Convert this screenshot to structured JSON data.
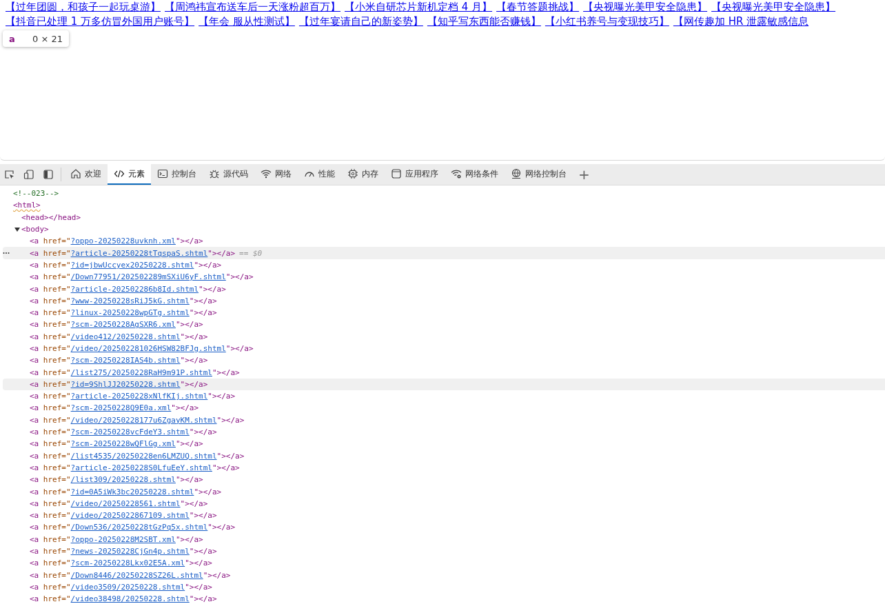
{
  "page": {
    "link_rows": [
      [
        "【过年团圆，和孩子一起玩桌游】",
        "【周鸿祎宣布送车后一天涨粉超百万】",
        "【小米自研芯片新机定档 4 月】",
        "【春节答题挑战】",
        "【央视曝光美甲安全隐患】",
        "【央视曝光美甲安全隐患】"
      ],
      [
        "【抖音已处理 1 万多仿冒外国用户账号】",
        "【年会 服从性测试】",
        "【过年宴请自己的新姿势】",
        "【知乎写东西能否赚钱】",
        "【小红书养号与变现技巧】",
        "【网传趣加 HR 泄露敏感信息"
      ]
    ],
    "tooltip": {
      "tag": "a",
      "size": "0 × 21"
    }
  },
  "devtools": {
    "tabs": [
      {
        "label": "欢迎",
        "selected": false
      },
      {
        "label": "元素",
        "selected": true
      },
      {
        "label": "控制台",
        "selected": false
      },
      {
        "label": "源代码",
        "selected": false
      },
      {
        "label": "网络",
        "selected": false
      },
      {
        "label": "性能",
        "selected": false
      },
      {
        "label": "内存",
        "selected": false
      },
      {
        "label": "应用程序",
        "selected": false
      },
      {
        "label": "网络条件",
        "selected": false
      },
      {
        "label": "网络控制台",
        "selected": false
      }
    ],
    "add_tab": "+",
    "tree": [
      {
        "kind": "comment",
        "text": "<!--023-->"
      },
      {
        "kind": "open",
        "text": "<html>",
        "issue": true,
        "children": [
          {
            "kind": "pair",
            "text": "<head></head>"
          },
          {
            "kind": "open",
            "text": "<body>",
            "expanded": true,
            "children": [
              {
                "kind": "link",
                "tag": "<a",
                "attr": " href=\"",
                "href": "?oppo-20250228uvknh.xml",
                "close": "\"></a>",
                "selected": false,
                "hovered": false
              },
              {
                "kind": "link",
                "tag": "<a",
                "attr": " href=\"",
                "href": "?article-20250228tTqspaS.shtml",
                "close": "\"></a>",
                "selected": true,
                "hovered": false,
                "note": "== $0"
              },
              {
                "kind": "link",
                "tag": "<a",
                "attr": " href=\"",
                "href": "?id=jbwUccyex20250228.shtml",
                "close": "\"></a>",
                "selected": false,
                "hovered": false
              },
              {
                "kind": "link",
                "tag": "<a",
                "attr": " href=\"",
                "href": "/Down77951/202502289mSXiU6yF.shtml",
                "close": "\"></a>",
                "selected": false,
                "hovered": false
              },
              {
                "kind": "link",
                "tag": "<a",
                "attr": " href=\"",
                "href": "?article-202502286b8Id.shtml",
                "close": "\"></a>",
                "selected": false,
                "hovered": false
              },
              {
                "kind": "link",
                "tag": "<a",
                "attr": " href=\"",
                "href": "?www-20250228sRiJ5kG.shtml",
                "close": "\"></a>",
                "selected": false,
                "hovered": false
              },
              {
                "kind": "link",
                "tag": "<a",
                "attr": " href=\"",
                "href": "?linux-20250228wpGTg.shtml",
                "close": "\"></a>",
                "selected": false,
                "hovered": false
              },
              {
                "kind": "link",
                "tag": "<a",
                "attr": " href=\"",
                "href": "?scm-20250228AgSXR6.xml",
                "close": "\"></a>",
                "selected": false,
                "hovered": false
              },
              {
                "kind": "link",
                "tag": "<a",
                "attr": " href=\"",
                "href": "/video412/20250228.shtml",
                "close": "\"></a>",
                "selected": false,
                "hovered": false
              },
              {
                "kind": "link",
                "tag": "<a",
                "attr": " href=\"",
                "href": "/video/202502281026HSW82BFJg.shtml",
                "close": "\"></a>",
                "selected": false,
                "hovered": false
              },
              {
                "kind": "link",
                "tag": "<a",
                "attr": " href=\"",
                "href": "?scm-20250228IAS4b.shtml",
                "close": "\"></a>",
                "selected": false,
                "hovered": false
              },
              {
                "kind": "link",
                "tag": "<a",
                "attr": " href=\"",
                "href": "/list275/20250228RaH9m91P.shtml",
                "close": "\"></a>",
                "selected": false,
                "hovered": false
              },
              {
                "kind": "link",
                "tag": "<a",
                "attr": " href=\"",
                "href": "?id=9ShlJJ20250228.shtml",
                "close": "\"></a>",
                "selected": false,
                "hovered": true
              },
              {
                "kind": "link",
                "tag": "<a",
                "attr": " href=\"",
                "href": "?article-20250228xNlfKIj.shtml",
                "close": "\"></a>",
                "selected": false,
                "hovered": false
              },
              {
                "kind": "link",
                "tag": "<a",
                "attr": " href=\"",
                "href": "?scm-20250228Q9E0a.xml",
                "close": "\"></a>",
                "selected": false,
                "hovered": false
              },
              {
                "kind": "link",
                "tag": "<a",
                "attr": " href=\"",
                "href": "/video/20250228177u6ZgayKM.shtml",
                "close": "\"></a>",
                "selected": false,
                "hovered": false
              },
              {
                "kind": "link",
                "tag": "<a",
                "attr": " href=\"",
                "href": "?scm-20250228vcFdeY3.shtml",
                "close": "\"></a>",
                "selected": false,
                "hovered": false
              },
              {
                "kind": "link",
                "tag": "<a",
                "attr": " href=\"",
                "href": "?scm-20250228wQFlGg.xml",
                "close": "\"></a>",
                "selected": false,
                "hovered": false
              },
              {
                "kind": "link",
                "tag": "<a",
                "attr": " href=\"",
                "href": "/list4535/20250228en6LMZUQ.shtml",
                "close": "\"></a>",
                "selected": false,
                "hovered": false
              },
              {
                "kind": "link",
                "tag": "<a",
                "attr": " href=\"",
                "href": "?article-20250228S0LfuEeY.shtml",
                "close": "\"></a>",
                "selected": false,
                "hovered": false
              },
              {
                "kind": "link",
                "tag": "<a",
                "attr": " href=\"",
                "href": "/list309/20250228.shtml",
                "close": "\"></a>",
                "selected": false,
                "hovered": false
              },
              {
                "kind": "link",
                "tag": "<a",
                "attr": " href=\"",
                "href": "?id=0A5iWk3bc20250228.shtml",
                "close": "\"></a>",
                "selected": false,
                "hovered": false
              },
              {
                "kind": "link",
                "tag": "<a",
                "attr": " href=\"",
                "href": "/video/20250228561.shtml",
                "close": "\"></a>",
                "selected": false,
                "hovered": false
              },
              {
                "kind": "link",
                "tag": "<a",
                "attr": " href=\"",
                "href": "/video/2025022867109.shtml",
                "close": "\"></a>",
                "selected": false,
                "hovered": false
              },
              {
                "kind": "link",
                "tag": "<a",
                "attr": " href=\"",
                "href": "/Down536/20250228tGzPq5x.shtml",
                "close": "\"></a>",
                "selected": false,
                "hovered": false
              },
              {
                "kind": "link",
                "tag": "<a",
                "attr": " href=\"",
                "href": "?oppo-20250228M2SBT.xml",
                "close": "\"></a>",
                "selected": false,
                "hovered": false
              },
              {
                "kind": "link",
                "tag": "<a",
                "attr": " href=\"",
                "href": "?news-20250228CjGn4p.shtml",
                "close": "\"></a>",
                "selected": false,
                "hovered": false
              },
              {
                "kind": "link",
                "tag": "<a",
                "attr": " href=\"",
                "href": "?scm-20250228Lkx02E5A.xml",
                "close": "\"></a>",
                "selected": false,
                "hovered": false
              },
              {
                "kind": "link",
                "tag": "<a",
                "attr": " href=\"",
                "href": "/Down8446/20250228SZ26L.shtml",
                "close": "\"></a>",
                "selected": false,
                "hovered": false
              },
              {
                "kind": "link",
                "tag": "<a",
                "attr": " href=\"",
                "href": "/video3509/20250228.shtml",
                "close": "\"></a>",
                "selected": false,
                "hovered": false
              },
              {
                "kind": "link",
                "tag": "<a",
                "attr": " href=\"",
                "href": "/video38498/20250228.shtml",
                "close": "\"></a>",
                "selected": false,
                "hovered": false
              }
            ]
          }
        ]
      }
    ]
  }
}
